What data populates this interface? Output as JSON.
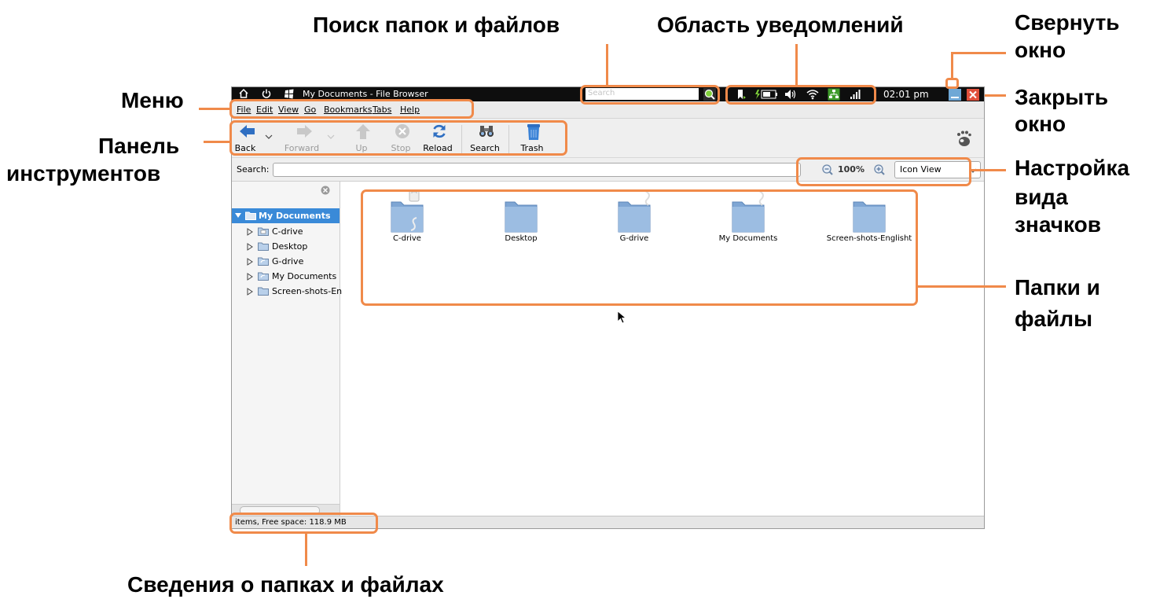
{
  "annotations": {
    "search": "Поиск папок и файлов",
    "notifications": "Область уведомлений",
    "minimize_l1": "Свернуть",
    "minimize_l2": "окно",
    "close_l1": "Закрыть",
    "close_l2": "окно",
    "menu": "Меню",
    "toolbar_l1": "Панель",
    "toolbar_l2": "инструментов",
    "view_l1": "Настройка",
    "view_l2": "вида",
    "view_l3": "значков",
    "folders_l1": "Папки и",
    "folders_l2": "файлы",
    "info": "Сведения о папках и файлах"
  },
  "window": {
    "title": "My Documents - File Browser",
    "search_placeholder": "Search",
    "clock": "02:01 pm"
  },
  "menu": [
    "File",
    "Edit",
    "View",
    "Go",
    "Bookmarks",
    "Tabs",
    "Help"
  ],
  "toolbar": {
    "back": "Back",
    "forward": "Forward",
    "up": "Up",
    "stop": "Stop",
    "reload": "Reload",
    "search": "Search",
    "trash": "Trash"
  },
  "location": {
    "search_label": "Search:",
    "zoom": "100%",
    "view_mode": "Icon View"
  },
  "sidebar": {
    "root": "My Documents",
    "items": [
      "C-drive",
      "Desktop",
      "G-drive",
      "My Documents",
      "Screen-shots-En"
    ]
  },
  "content": {
    "items": [
      "C-drive",
      "Desktop",
      "G-drive",
      "My Documents",
      "Screen-shots-Englisht"
    ]
  },
  "status": "items, Free space: 118.9 MB",
  "colors": {
    "accent": "#f08a4a",
    "folder": "#7fa6d4",
    "selection": "#3a8ad8"
  }
}
